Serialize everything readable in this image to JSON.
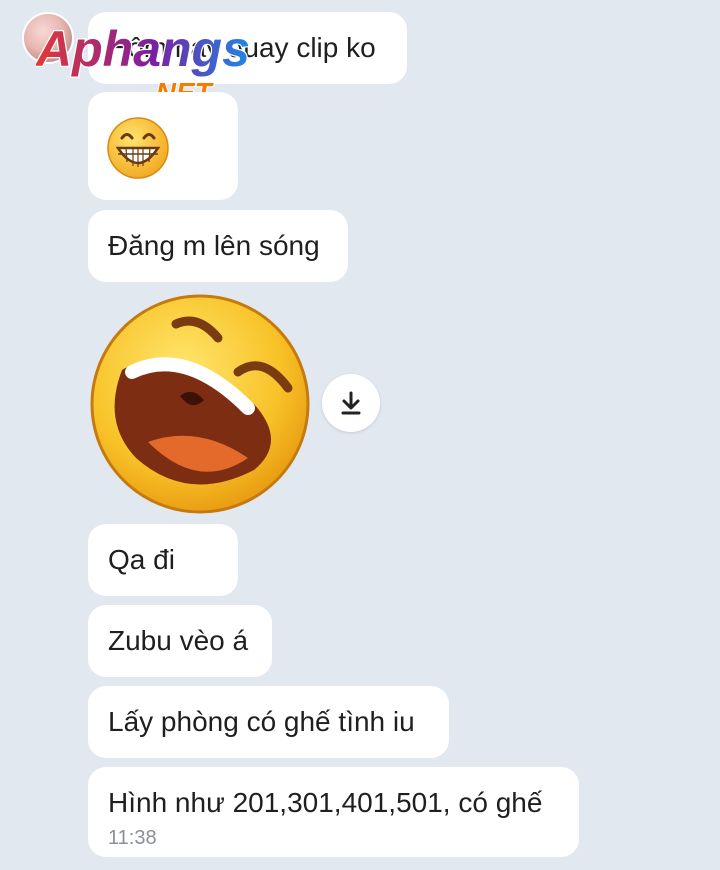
{
  "messages": [
    {
      "text": "Hôm nay quay clip ko"
    },
    {
      "emoji": "grinning-face-icon"
    },
    {
      "text": "Đăng m lên sóng"
    },
    {
      "sticker": "laughing-face-sticker"
    },
    {
      "text": "Qa đi"
    },
    {
      "text": "Zubu vèo á"
    },
    {
      "text": "Lấy phòng có ghế tình iu"
    },
    {
      "text": "Hình như 201,301,401,501, có ghế",
      "time": "11:38"
    }
  ],
  "watermark": {
    "name": "Aphangs",
    "tld": ".NET"
  },
  "colors": {
    "background": "#e2e8f0",
    "bubble": "#ffffff",
    "text": "#1f1f1f",
    "timestamp": "#8a8f98"
  }
}
